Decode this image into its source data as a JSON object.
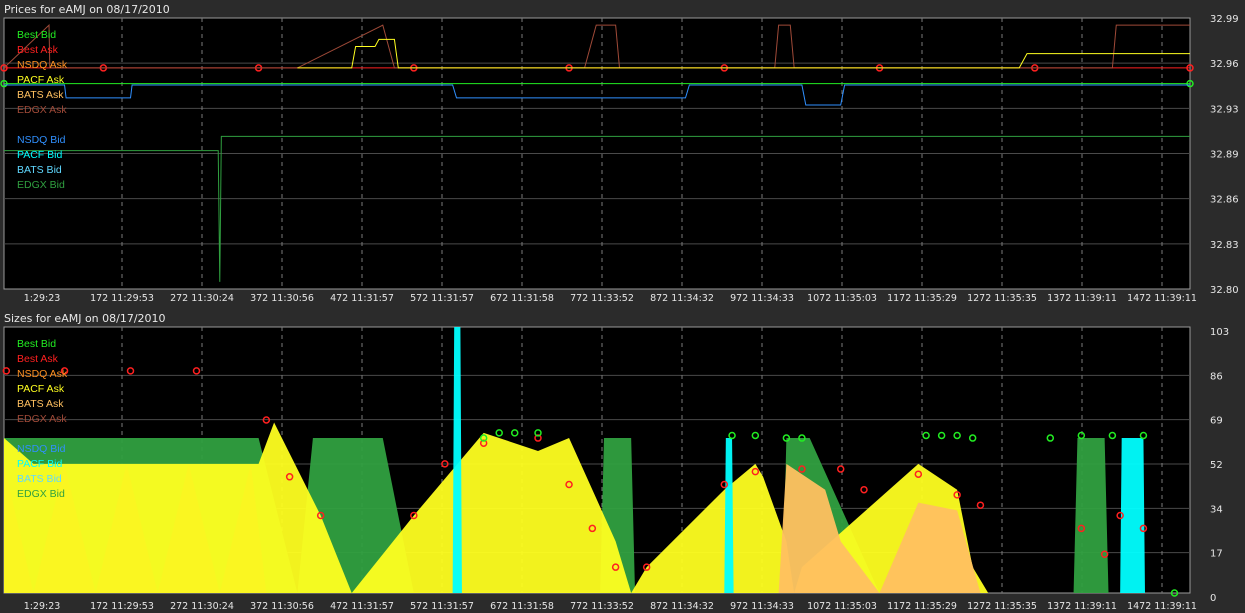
{
  "colors": {
    "best_bid": "#22ee22",
    "best_ask": "#ff2020",
    "nsdq_ask": "#ff9020",
    "pacf_ask": "#ffff20",
    "bats_ask": "#ffc060",
    "edgx_ask": "#a04a38",
    "nsdq_bid": "#3090ff",
    "pacf_bid": "#00ffff",
    "bats_bid": "#60d8ff",
    "edgx_bid": "#30a040"
  },
  "legend": [
    {
      "label": "Best Bid",
      "color_key": "best_bid"
    },
    {
      "label": "Best Ask",
      "color_key": "best_ask"
    },
    {
      "label": "NSDQ Ask",
      "color_key": "nsdq_ask"
    },
    {
      "label": "PACF Ask",
      "color_key": "pacf_ask"
    },
    {
      "label": "BATS Ask",
      "color_key": "bats_ask"
    },
    {
      "label": "EDGX Ask",
      "color_key": "edgx_ask"
    },
    {
      "label": "NSDQ Bid",
      "color_key": "nsdq_bid"
    },
    {
      "label": "PACF Bid",
      "color_key": "pacf_bid"
    },
    {
      "label": "BATS Bid",
      "color_key": "bats_bid"
    },
    {
      "label": "EDGX Bid",
      "color_key": "edgx_bid"
    }
  ],
  "chart_data": [
    {
      "type": "line",
      "title": "Prices for  eAMJ  on  08/17/2010",
      "x_ticks": [
        "1:29:23",
        "172 11:29:53",
        "272 11:30:24",
        "372 11:30:56",
        "472 11:31:57",
        "572 11:31:57",
        "672 11:31:58",
        "772 11:33:52",
        "872 11:34:32",
        "972 11:34:33",
        "1072 11:35:03",
        "1172 11:35:29",
        "1272 11:35:35",
        "1372 11:39:11",
        "1472 11:39:11"
      ],
      "y_ticks": [
        "32.99",
        "32.96",
        "32.93",
        "32.89",
        "32.86",
        "32.83",
        "32.80"
      ],
      "ylim": [
        32.8,
        32.99
      ],
      "x_range": [
        72,
        1600
      ],
      "series": [
        {
          "name": "Best Ask",
          "color_key": "best_ask",
          "values": [
            [
              72,
              32.955
            ],
            [
              200,
              32.955
            ],
            [
              400,
              32.955
            ],
            [
              600,
              32.955
            ],
            [
              800,
              32.955
            ],
            [
              1000,
              32.955
            ],
            [
              1200,
              32.955
            ],
            [
              1400,
              32.955
            ],
            [
              1600,
              32.955
            ]
          ]
        },
        {
          "name": "EDGX Ask",
          "color_key": "edgx_ask",
          "values": [
            [
              72,
              32.955
            ],
            [
              130,
              32.985
            ],
            [
              131,
              32.955
            ],
            [
              450,
              32.955
            ],
            [
              560,
              32.985
            ],
            [
              575,
              32.955
            ],
            [
              820,
              32.955
            ],
            [
              835,
              32.985
            ],
            [
              860,
              32.985
            ],
            [
              865,
              32.955
            ],
            [
              1065,
              32.955
            ],
            [
              1070,
              32.985
            ],
            [
              1085,
              32.985
            ],
            [
              1090,
              32.955
            ],
            [
              1440,
              32.955
            ],
            [
              1500,
              32.955
            ],
            [
              1505,
              32.985
            ],
            [
              1600,
              32.985
            ]
          ]
        },
        {
          "name": "PACF Ask",
          "color_key": "pacf_ask",
          "values": [
            [
              450,
              32.955
            ],
            [
              520,
              32.955
            ],
            [
              525,
              32.97
            ],
            [
              550,
              32.97
            ],
            [
              555,
              32.975
            ],
            [
              575,
              32.975
            ],
            [
              580,
              32.955
            ],
            [
              1380,
              32.955
            ],
            [
              1390,
              32.965
            ],
            [
              1600,
              32.965
            ]
          ]
        },
        {
          "name": "Best Bid",
          "color_key": "best_bid",
          "values": [
            [
              72,
              32.944
            ],
            [
              1600,
              32.944
            ]
          ]
        },
        {
          "name": "NSDQ Bid",
          "color_key": "nsdq_bid",
          "values": [
            [
              72,
              32.943
            ],
            [
              150,
              32.943
            ],
            [
              152,
              32.934
            ],
            [
              235,
              32.934
            ],
            [
              237,
              32.943
            ],
            [
              650,
              32.943
            ],
            [
              655,
              32.934
            ],
            [
              950,
              32.934
            ],
            [
              955,
              32.943
            ],
            [
              1100,
              32.943
            ],
            [
              1105,
              32.929
            ],
            [
              1150,
              32.929
            ],
            [
              1155,
              32.943
            ],
            [
              1600,
              32.943
            ]
          ]
        },
        {
          "name": "EDGX Bid",
          "color_key": "edgx_bid",
          "values": [
            [
              72,
              32.897
            ],
            [
              348,
              32.897
            ],
            [
              350,
              32.805
            ],
            [
              352,
              32.907
            ],
            [
              1600,
              32.907
            ]
          ]
        }
      ]
    },
    {
      "type": "area",
      "title": "Sizes for  eAMJ  on  08/17/2010",
      "x_ticks": [
        "1:29:23",
        "172 11:29:53",
        "272 11:30:24",
        "372 11:30:56",
        "472 11:31:57",
        "572 11:31:57",
        "672 11:31:58",
        "772 11:33:52",
        "872 11:34:32",
        "972 11:34:33",
        "1072 11:35:03",
        "1172 11:35:29",
        "1272 11:35:35",
        "1372 11:39:11",
        "1472 11:39:11"
      ],
      "y_ticks": [
        "103",
        "86",
        "69",
        "52",
        "34",
        "17",
        "0"
      ],
      "ylim": [
        0,
        103
      ],
      "x_range": [
        72,
        1600
      ],
      "series": [
        {
          "name": "EDGX Bid",
          "color_key": "edgx_bid",
          "values": [
            [
              72,
              60
            ],
            [
              110,
              60
            ],
            [
              400,
              60
            ],
            [
              450,
              0
            ],
            [
              470,
              60
            ],
            [
              560,
              60
            ],
            [
              600,
              0
            ],
            [
              840,
              0
            ],
            [
              845,
              60
            ],
            [
              880,
              60
            ],
            [
              885,
              0
            ],
            [
              1075,
              0
            ],
            [
              1080,
              60
            ],
            [
              1110,
              60
            ],
            [
              1200,
              0
            ],
            [
              1450,
              0
            ],
            [
              1455,
              60
            ],
            [
              1490,
              60
            ],
            [
              1495,
              0
            ],
            [
              1600,
              0
            ]
          ]
        },
        {
          "name": "EDGX Ask",
          "color_key": "edgx_ask",
          "values": [
            [
              72,
              50
            ],
            [
              110,
              0
            ],
            [
              150,
              50
            ],
            [
              190,
              0
            ],
            [
              230,
              50
            ],
            [
              270,
              0
            ],
            [
              310,
              50
            ],
            [
              350,
              0
            ],
            [
              390,
              50
            ],
            [
              410,
              0
            ],
            [
              1600,
              0
            ]
          ]
        },
        {
          "name": "PACF Ask",
          "color_key": "pacf_ask",
          "values": [
            [
              72,
              60
            ],
            [
              110,
              50
            ],
            [
              400,
              50
            ],
            [
              420,
              66
            ],
            [
              480,
              30
            ],
            [
              520,
              0
            ],
            [
              600,
              30
            ],
            [
              690,
              62
            ],
            [
              760,
              55
            ],
            [
              800,
              60
            ],
            [
              860,
              20
            ],
            [
              880,
              0
            ],
            [
              900,
              10
            ],
            [
              1000,
              40
            ],
            [
              1040,
              50
            ],
            [
              1050,
              45
            ],
            [
              1080,
              20
            ],
            [
              1090,
              0
            ],
            [
              1100,
              10
            ],
            [
              1250,
              50
            ],
            [
              1300,
              40
            ],
            [
              1320,
              10
            ],
            [
              1340,
              0
            ],
            [
              1600,
              0
            ]
          ]
        },
        {
          "name": "BATS Ask",
          "color_key": "bats_ask",
          "values": [
            [
              72,
              0
            ],
            [
              1070,
              0
            ],
            [
              1080,
              50
            ],
            [
              1130,
              40
            ],
            [
              1150,
              20
            ],
            [
              1200,
              0
            ],
            [
              1250,
              35
            ],
            [
              1300,
              32
            ],
            [
              1330,
              0
            ],
            [
              1600,
              0
            ]
          ]
        },
        {
          "name": "PACF Bid",
          "color_key": "pacf_bid",
          "values": [
            [
              72,
              0
            ],
            [
              650,
              0
            ],
            [
              652,
              103
            ],
            [
              660,
              103
            ],
            [
              662,
              0
            ],
            [
              1000,
              0
            ],
            [
              1002,
              60
            ],
            [
              1010,
              60
            ],
            [
              1012,
              0
            ],
            [
              1510,
              0
            ],
            [
              1512,
              60
            ],
            [
              1540,
              60
            ],
            [
              1542,
              0
            ],
            [
              1600,
              0
            ]
          ]
        },
        {
          "name": "Best Ask",
          "color_key": "best_ask",
          "values": [
            [
              75,
              86
            ],
            [
              150,
              86
            ],
            [
              235,
              86
            ],
            [
              320,
              86
            ],
            [
              410,
              67
            ],
            [
              440,
              45
            ],
            [
              480,
              30
            ],
            [
              600,
              30
            ],
            [
              640,
              50
            ],
            [
              690,
              58
            ],
            [
              760,
              60
            ],
            [
              800,
              42
            ],
            [
              830,
              25
            ],
            [
              860,
              10
            ],
            [
              900,
              10
            ],
            [
              1000,
              42
            ],
            [
              1040,
              47
            ],
            [
              1100,
              48
            ],
            [
              1150,
              48
            ],
            [
              1180,
              40
            ],
            [
              1250,
              46
            ],
            [
              1300,
              38
            ],
            [
              1330,
              34
            ],
            [
              1460,
              25
            ],
            [
              1490,
              15
            ],
            [
              1510,
              30
            ],
            [
              1540,
              25
            ]
          ]
        },
        {
          "name": "Best Bid",
          "color_key": "best_bid",
          "values": [
            [
              690,
              60
            ],
            [
              710,
              62
            ],
            [
              730,
              62
            ],
            [
              760,
              62
            ],
            [
              1010,
              61
            ],
            [
              1040,
              61
            ],
            [
              1080,
              60
            ],
            [
              1100,
              60
            ],
            [
              1260,
              61
            ],
            [
              1280,
              61
            ],
            [
              1300,
              61
            ],
            [
              1320,
              60
            ],
            [
              1420,
              60
            ],
            [
              1460,
              61
            ],
            [
              1500,
              61
            ],
            [
              1540,
              61
            ],
            [
              1580,
              0
            ]
          ]
        }
      ]
    }
  ]
}
